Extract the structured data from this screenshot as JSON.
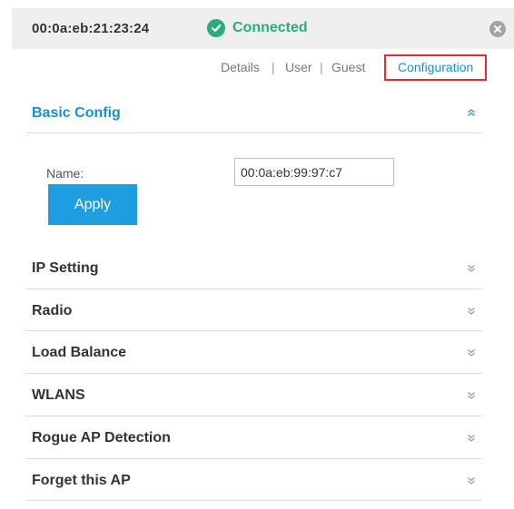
{
  "header": {
    "mac_address": "00:0a:eb:21:23:24",
    "status": "Connected",
    "status_color": "#2bab7f"
  },
  "tabs": [
    {
      "label": "Details"
    },
    {
      "label": "User"
    },
    {
      "label": "Guest"
    },
    {
      "label": "Configuration",
      "active": true
    }
  ],
  "tab_separator": "|",
  "basic_config": {
    "title": "Basic Config",
    "expanded": true,
    "name_label": "Name:",
    "name_value": "00:0a:eb:99:97:c7",
    "apply_label": "Apply"
  },
  "sections": [
    {
      "title": "IP Setting"
    },
    {
      "title": "Radio"
    },
    {
      "title": "Load Balance"
    },
    {
      "title": "WLANS"
    },
    {
      "title": "Rogue AP Detection"
    },
    {
      "title": "Forget this AP"
    }
  ],
  "colors": {
    "accent": "#1a8ed3",
    "button": "#1e9ee0",
    "highlight_box": "#e12d2d"
  },
  "icons": {
    "status": "check-circle-icon",
    "close": "close-circle-icon",
    "expanded": "double-chevron-up-icon",
    "collapsed": "double-chevron-down-icon"
  }
}
